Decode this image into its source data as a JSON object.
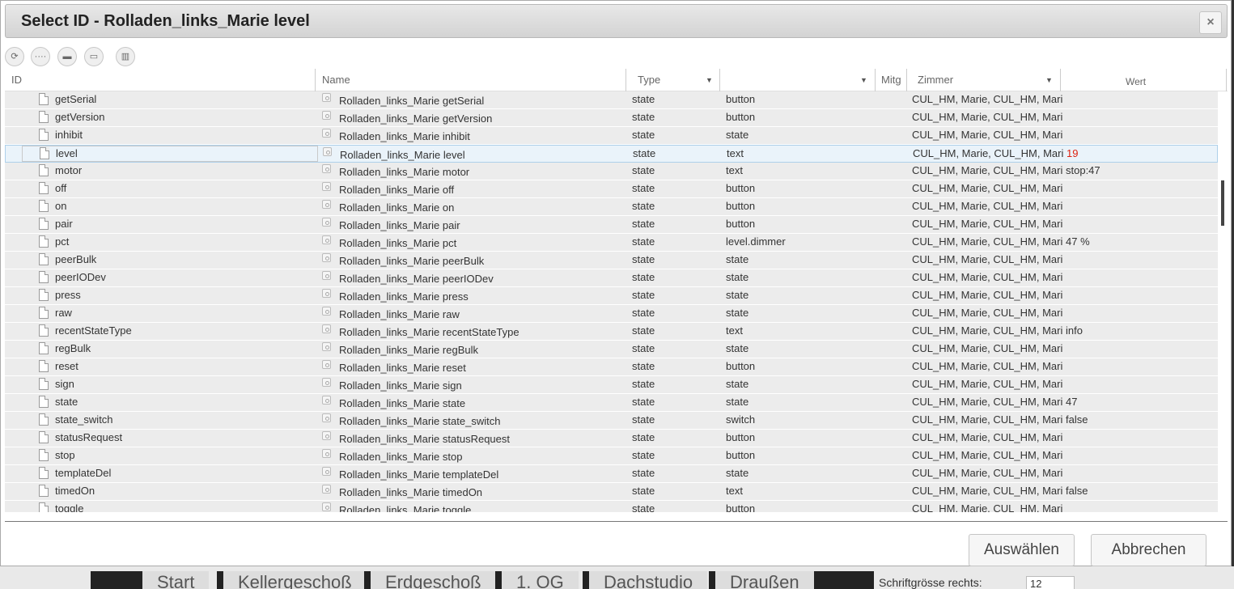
{
  "background": {
    "tabs": [
      "Start",
      "Kellergeschoß",
      "Erdgeschoß",
      "1. OG",
      "Dachstudio",
      "Draußen"
    ],
    "label": "Schriftgrösse rechts:",
    "input_value": "12"
  },
  "dialog": {
    "title": "Select ID - Rolladen_links_Marie level",
    "close_icon": "×",
    "toolbar": [
      {
        "icon": "refresh-icon",
        "glyph": "⟳"
      },
      {
        "icon": "list-icon",
        "glyph": "····"
      },
      {
        "icon": "folder-closed-icon",
        "glyph": "▬"
      },
      {
        "icon": "folder-open-icon",
        "glyph": "▭"
      },
      {
        "icon": "columns-icon",
        "glyph": "▥"
      }
    ],
    "columns": {
      "id": "ID",
      "name": "Name",
      "type": "Type",
      "role": "",
      "mitg": "Mitg",
      "zimmer": "Zimmer",
      "wert": "Wert"
    },
    "rows": [
      {
        "id": "getSerial",
        "name": "Rolladen_links_Marie getSerial",
        "type": "state",
        "role": "button",
        "zimmer": "CUL_HM, Marie, CUL_HM, Marie",
        "wert": ""
      },
      {
        "id": "getVersion",
        "name": "Rolladen_links_Marie getVersion",
        "type": "state",
        "role": "button",
        "zimmer": "CUL_HM, Marie, CUL_HM, Marie",
        "wert": ""
      },
      {
        "id": "inhibit",
        "name": "Rolladen_links_Marie inhibit",
        "type": "state",
        "role": "state",
        "zimmer": "CUL_HM, Marie, CUL_HM, Marie",
        "wert": ""
      },
      {
        "id": "level",
        "name": "Rolladen_links_Marie level",
        "type": "state",
        "role": "text",
        "zimmer": "CUL_HM, Marie, CUL_HM, Marie",
        "wert": "19"
      },
      {
        "id": "motor",
        "name": "Rolladen_links_Marie motor",
        "type": "state",
        "role": "text",
        "zimmer": "CUL_HM, Marie, CUL_HM, Marie",
        "wert": "stop:47"
      },
      {
        "id": "off",
        "name": "Rolladen_links_Marie off",
        "type": "state",
        "role": "button",
        "zimmer": "CUL_HM, Marie, CUL_HM, Marie",
        "wert": ""
      },
      {
        "id": "on",
        "name": "Rolladen_links_Marie on",
        "type": "state",
        "role": "button",
        "zimmer": "CUL_HM, Marie, CUL_HM, Marie",
        "wert": ""
      },
      {
        "id": "pair",
        "name": "Rolladen_links_Marie pair",
        "type": "state",
        "role": "button",
        "zimmer": "CUL_HM, Marie, CUL_HM, Marie",
        "wert": ""
      },
      {
        "id": "pct",
        "name": "Rolladen_links_Marie pct",
        "type": "state",
        "role": "level.dimmer",
        "zimmer": "CUL_HM, Marie, CUL_HM, Marie",
        "wert": "47 %"
      },
      {
        "id": "peerBulk",
        "name": "Rolladen_links_Marie peerBulk",
        "type": "state",
        "role": "state",
        "zimmer": "CUL_HM, Marie, CUL_HM, Marie",
        "wert": ""
      },
      {
        "id": "peerIODev",
        "name": "Rolladen_links_Marie peerIODev",
        "type": "state",
        "role": "state",
        "zimmer": "CUL_HM, Marie, CUL_HM, Marie",
        "wert": ""
      },
      {
        "id": "press",
        "name": "Rolladen_links_Marie press",
        "type": "state",
        "role": "state",
        "zimmer": "CUL_HM, Marie, CUL_HM, Marie",
        "wert": ""
      },
      {
        "id": "raw",
        "name": "Rolladen_links_Marie raw",
        "type": "state",
        "role": "state",
        "zimmer": "CUL_HM, Marie, CUL_HM, Marie",
        "wert": ""
      },
      {
        "id": "recentStateType",
        "name": "Rolladen_links_Marie recentStateType",
        "type": "state",
        "role": "text",
        "zimmer": "CUL_HM, Marie, CUL_HM, Marie",
        "wert": "info"
      },
      {
        "id": "regBulk",
        "name": "Rolladen_links_Marie regBulk",
        "type": "state",
        "role": "state",
        "zimmer": "CUL_HM, Marie, CUL_HM, Marie",
        "wert": ""
      },
      {
        "id": "reset",
        "name": "Rolladen_links_Marie reset",
        "type": "state",
        "role": "button",
        "zimmer": "CUL_HM, Marie, CUL_HM, Marie",
        "wert": ""
      },
      {
        "id": "sign",
        "name": "Rolladen_links_Marie sign",
        "type": "state",
        "role": "state",
        "zimmer": "CUL_HM, Marie, CUL_HM, Marie",
        "wert": ""
      },
      {
        "id": "state",
        "name": "Rolladen_links_Marie state",
        "type": "state",
        "role": "state",
        "zimmer": "CUL_HM, Marie, CUL_HM, Marie",
        "wert": "47"
      },
      {
        "id": "state_switch",
        "name": "Rolladen_links_Marie state_switch",
        "type": "state",
        "role": "switch",
        "zimmer": "CUL_HM, Marie, CUL_HM, Marie",
        "wert": "false"
      },
      {
        "id": "statusRequest",
        "name": "Rolladen_links_Marie statusRequest",
        "type": "state",
        "role": "button",
        "zimmer": "CUL_HM, Marie, CUL_HM, Marie",
        "wert": ""
      },
      {
        "id": "stop",
        "name": "Rolladen_links_Marie stop",
        "type": "state",
        "role": "button",
        "zimmer": "CUL_HM, Marie, CUL_HM, Marie",
        "wert": ""
      },
      {
        "id": "templateDel",
        "name": "Rolladen_links_Marie templateDel",
        "type": "state",
        "role": "state",
        "zimmer": "CUL_HM, Marie, CUL_HM, Marie",
        "wert": ""
      },
      {
        "id": "timedOn",
        "name": "Rolladen_links_Marie timedOn",
        "type": "state",
        "role": "text",
        "zimmer": "CUL_HM, Marie, CUL_HM, Marie",
        "wert": "false"
      },
      {
        "id": "toggle",
        "name": "Rolladen_links_Marie toggle",
        "type": "state",
        "role": "button",
        "zimmer": "CUL_HM, Marie, CUL_HM, Marie",
        "wert": ""
      }
    ],
    "selected_row": "level",
    "buttons": {
      "select": "Auswählen",
      "cancel": "Abbrechen"
    }
  },
  "colors": {
    "selected_row_bg": "#eaf3fa",
    "value_highlight": "#dd2211"
  }
}
